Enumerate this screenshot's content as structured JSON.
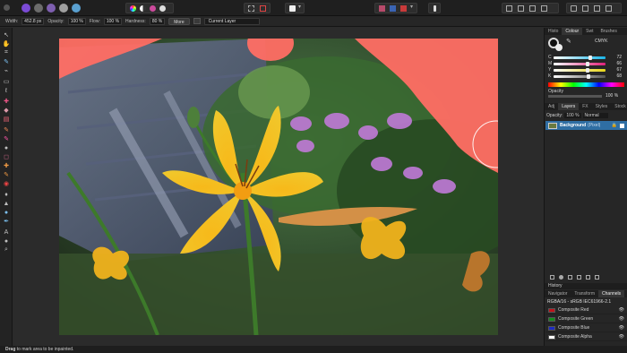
{
  "context_toolbar": {
    "width_label": "Width:",
    "width_value": "452.8 px",
    "opacity_label": "Opacity:",
    "opacity_value": "100 %",
    "flow_label": "Flow:",
    "flow_value": "100 %",
    "hardness_label": "Hardness:",
    "hardness_value": "80 %",
    "more_label": "More",
    "source_value": "Current Layer"
  },
  "panel": {
    "top_tabs": [
      "Histo",
      "Colour",
      "Swt",
      "Brushes"
    ],
    "colour_model": "CMYK",
    "channels": [
      {
        "label": "C",
        "value": "72",
        "color": "#19b5e8",
        "level": 0.72
      },
      {
        "label": "M",
        "value": "66",
        "color": "#e0207a",
        "level": 0.66
      },
      {
        "label": "Y",
        "value": "67",
        "color": "#e8d619",
        "level": 0.67
      },
      {
        "label": "K",
        "value": "68",
        "color": "#555555",
        "level": 0.68
      }
    ],
    "opacity_label": "Opacity",
    "opacity_value": "100 %",
    "layer_tabs": [
      "Adj",
      "Layers",
      "FX",
      "Styles",
      "Stock"
    ],
    "layer_opacity_label": "Opacity:",
    "layer_opacity_value": "100 %",
    "blend_mode": "Normal",
    "layer_name": "Background",
    "layer_type": "(Pixel)",
    "history_label": "History",
    "bottom_tabs": [
      "Navigator",
      "Transform",
      "Channels"
    ],
    "colorspace": "RGBA/16 - sRGB IEC61966-2.1",
    "composites": [
      {
        "name": "Composite Red",
        "color": "#c0131b"
      },
      {
        "name": "Composite Green",
        "color": "#138a1b"
      },
      {
        "name": "Composite Blue",
        "color": "#1b2ac0"
      },
      {
        "name": "Composite Alpha",
        "color": "#ffffff"
      }
    ]
  },
  "status": {
    "bold": "Drag",
    "text": " to mark area to be inpainted."
  },
  "colors": {
    "accent": "#2f6ea3",
    "mask": "#ff6e64"
  }
}
